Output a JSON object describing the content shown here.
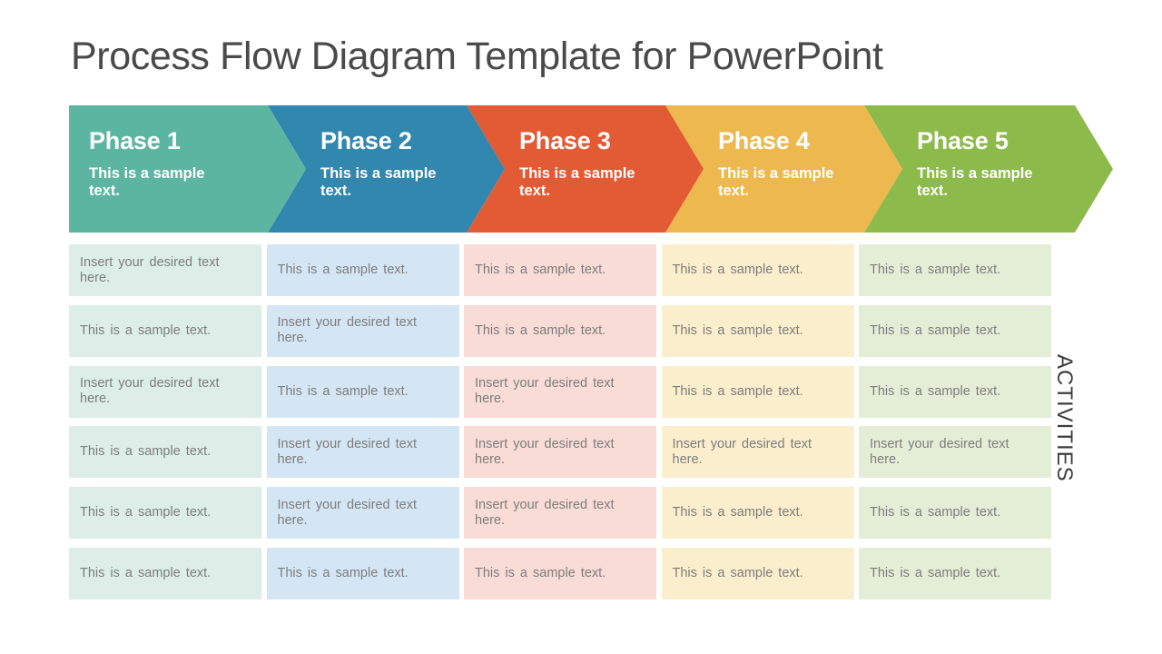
{
  "page_title": "Process Flow Diagram Template for PowerPoint",
  "axis_label": "ACTIVITIES",
  "background_color": "#ffffff",
  "title_color": "#4a4a4a",
  "cell_text_color": "#7d7d7d",
  "phases": [
    {
      "label": "Phase 1",
      "subtitle": "This is a sample text.",
      "color": "#5cb5a0",
      "cell_color": "#dceee7"
    },
    {
      "label": "Phase 2",
      "subtitle": "This is a sample text.",
      "color": "#3287af",
      "cell_color": "#d4e6f3"
    },
    {
      "label": "Phase 3",
      "subtitle": "This is a sample text.",
      "color": "#e35b35",
      "cell_color": "#f8dcd5"
    },
    {
      "label": "Phase 4",
      "subtitle": "This is a sample text.",
      "color": "#edb84e",
      "cell_color": "#fbeecd"
    },
    {
      "label": "Phase 5",
      "subtitle": "This is a sample text.",
      "color": "#8cba4b",
      "cell_color": "#e4eed7"
    }
  ],
  "activity_rows": [
    [
      "Insert your desired text here.",
      "This is a sample text.",
      "This is a sample text.",
      "This is a sample text.",
      "This is a sample text."
    ],
    [
      "This is a sample text.",
      "Insert your desired text here.",
      "This is a sample text.",
      "This is a sample text.",
      "This is a sample text."
    ],
    [
      "Insert your desired text here.",
      "This is a sample text.",
      "Insert your desired text here.",
      "This is a sample text.",
      "This is a sample text."
    ],
    [
      "This is a sample text.",
      "Insert your desired text here.",
      "Insert your desired text here.",
      "Insert your desired text here.",
      "Insert your desired text here."
    ],
    [
      "This is a sample text.",
      "Insert your desired text here.",
      "Insert your desired text here.",
      "This is a sample text.",
      "This is a sample text."
    ],
    [
      "This is a sample text.",
      "This is a sample text.",
      "This is a sample text.",
      "This is a sample text.",
      "This is a sample text."
    ]
  ]
}
